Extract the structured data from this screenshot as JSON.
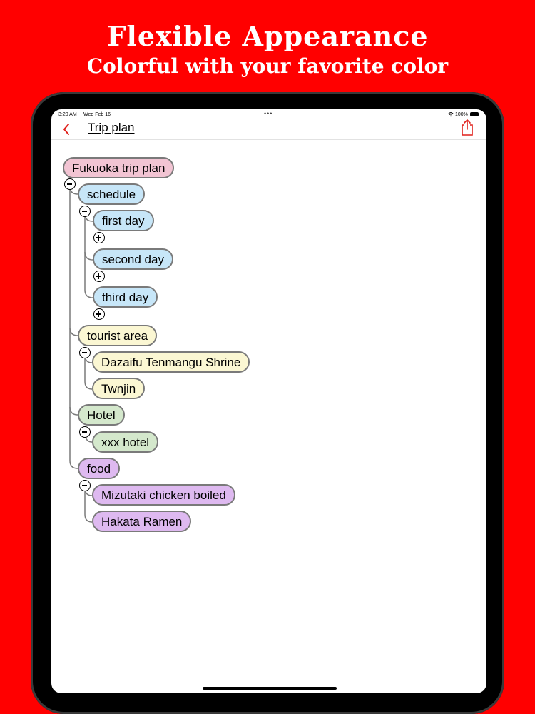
{
  "promo": {
    "title": "Flexible Appearance",
    "subtitle": "Colorful with your favorite color"
  },
  "status_bar": {
    "time": "3:20 AM",
    "date": "Wed Feb 16",
    "battery": "100%"
  },
  "nav": {
    "title": "Trip plan",
    "back_icon": "chevron-left-icon",
    "share_icon": "share-icon"
  },
  "colors": {
    "accent": "#e0201b",
    "background": "#ff0000",
    "pink": "#f2c4d3",
    "blue": "#c7e6f8",
    "yellow": "#fbf7d3",
    "green": "#d4e8cc",
    "purple": "#deb9f0"
  },
  "tree": {
    "root": "Fukuoka trip plan",
    "schedule": {
      "label": "schedule",
      "children": [
        "first day",
        "second day",
        "third day"
      ]
    },
    "tourist_area": {
      "label": "tourist area",
      "children": [
        "Dazaifu Tenmangu Shrine",
        "Twnjin"
      ]
    },
    "hotel": {
      "label": "Hotel",
      "children": [
        "xxx hotel"
      ]
    },
    "food": {
      "label": "food",
      "children": [
        "Mizutaki chicken boiled",
        "Hakata Ramen"
      ]
    }
  }
}
